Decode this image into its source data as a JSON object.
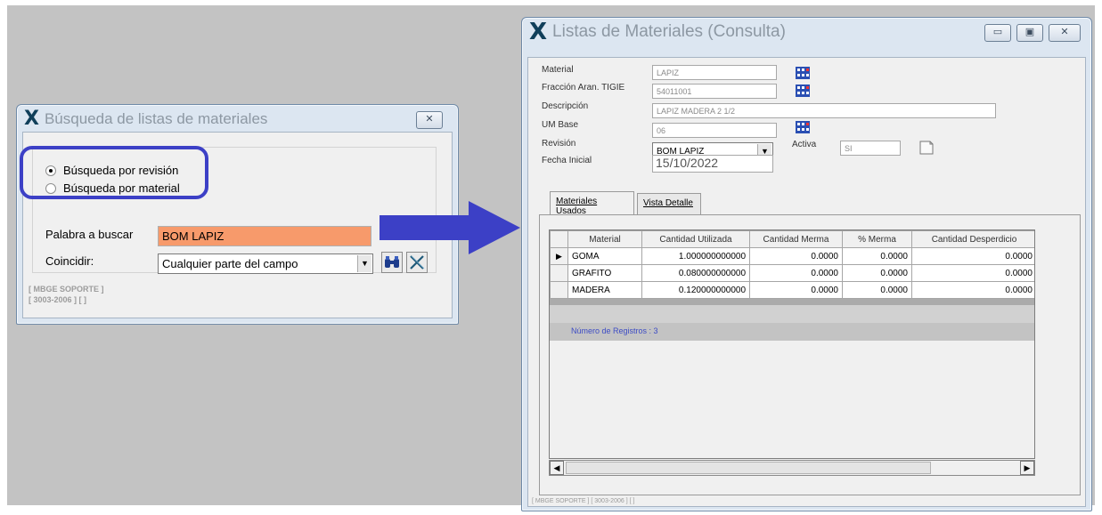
{
  "search_dialog": {
    "title": "Búsqueda de listas de materiales",
    "close_label": "✕",
    "radio_revision": "Búsqueda por revisión",
    "radio_material": "Búsqueda por material",
    "selected_mode": "revision",
    "search_label": "Palabra a buscar",
    "search_value": "BOM LAPIZ",
    "match_label": "Coincidir:",
    "match_value": "Cualquier parte del campo",
    "footer_line1": "[ MBGE SOPORTE ]",
    "footer_line2": "[ 3003-2006 ]  [  ]"
  },
  "materials_window": {
    "title": "Listas de Materiales (Consulta)",
    "min_label": "▭",
    "max_label": "▣",
    "close_label": "✕",
    "fields": {
      "material_label": "Material",
      "material_value": "LAPIZ",
      "fraccion_label": "Fracción Aran. TIGIE",
      "fraccion_value": "54011001",
      "descripcion_label": "Descripción",
      "descripcion_value": "LAPIZ MADERA 2 1/2",
      "um_label": "UM Base",
      "um_value": "06",
      "revision_label": "Revisión",
      "revision_value": "BOM LAPIZ",
      "activa_label": "Activa",
      "activa_value": "SI",
      "fecha_label": "Fecha Inicial",
      "fecha_value": "15/10/2022"
    },
    "tabs": [
      {
        "label": "Materiales Usados"
      },
      {
        "label": "Vista Detalle"
      }
    ],
    "grid": {
      "columns": [
        "Material",
        "Cantidad Utilizada",
        "Cantidad Merma",
        "% Merma",
        "Cantidad Desperdicio"
      ],
      "rows": [
        [
          "GOMA",
          "1.000000000000",
          "0.0000",
          "0.0000",
          "0.0000"
        ],
        [
          "GRAFITO",
          "0.080000000000",
          "0.0000",
          "0.0000",
          "0.0000"
        ],
        [
          "MADERA",
          "0.120000000000",
          "0.0000",
          "0.0000",
          "0.0000"
        ]
      ],
      "record_count": "Número de Registros : 3"
    },
    "footer": "[ MBGE SOPORTE ]  [ 3003-2006 ]  [  ]"
  },
  "colors": {
    "highlight_oval": "#3c40c6",
    "arrow": "#3c40c6",
    "search_field_bg": "#f79a6b",
    "record_count_text": "#3d4cc4"
  }
}
